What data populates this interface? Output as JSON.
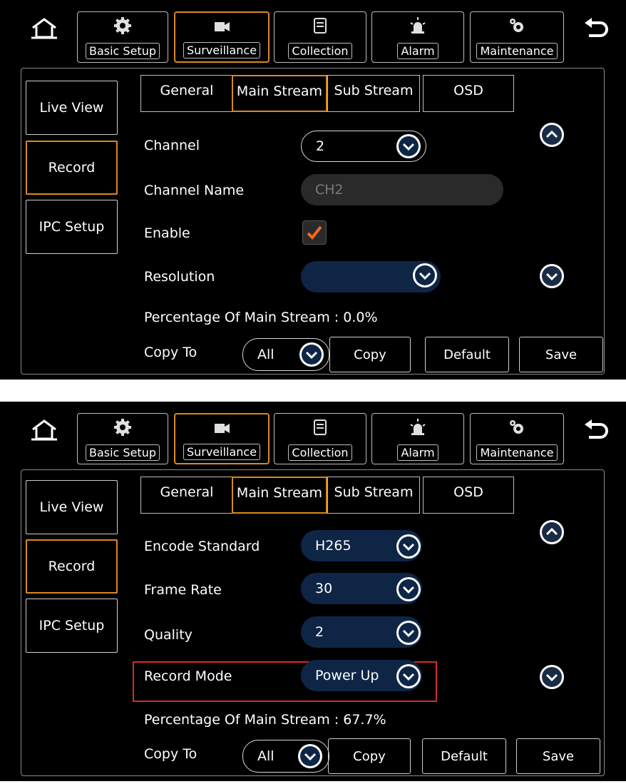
{
  "nav": {
    "tabs": [
      "Basic Setup",
      "Surveillance",
      "Collection",
      "Alarm",
      "Maintenance"
    ],
    "active": "Surveillance"
  },
  "sidebar": {
    "items": [
      "Live View",
      "Record",
      "IPC Setup"
    ],
    "active": "Record"
  },
  "subtabs": {
    "items": [
      "General",
      "Main Stream",
      "Sub Stream",
      "OSD"
    ],
    "active": "Main Stream"
  },
  "panel1": {
    "channel_label": "Channel",
    "channel_value": "2",
    "channel_name_label": "Channel Name",
    "channel_name_placeholder": "CH2",
    "enable_label": "Enable",
    "resolution_label": "Resolution",
    "resolution_value": "",
    "percentage": "Percentage Of Main Stream : 0.0%"
  },
  "panel2": {
    "encode_label": "Encode Standard",
    "encode_value": "H265",
    "frame_rate_label": "Frame Rate",
    "frame_rate_value": "30",
    "quality_label": "Quality",
    "quality_value": "2",
    "record_mode_label": "Record Mode",
    "record_mode_value": "Power Up",
    "percentage": "Percentage Of Main Stream : 67.7%"
  },
  "footer": {
    "copy_to_label": "Copy To",
    "copy_to_value": "All",
    "copy_button": "Copy",
    "default_button": "Default",
    "save_button": "Save"
  },
  "colors": {
    "accent": "#d88a1a",
    "pill": "#0e2546",
    "highlight": "#d42a2a"
  },
  "icons": [
    "home-icon",
    "gear-icon",
    "camera-icon",
    "document-icon",
    "alarm-icon",
    "maintenance-gear-icon",
    "back-arrow-icon",
    "chevron-down-icon",
    "chevron-up-icon",
    "checkmark-icon"
  ]
}
